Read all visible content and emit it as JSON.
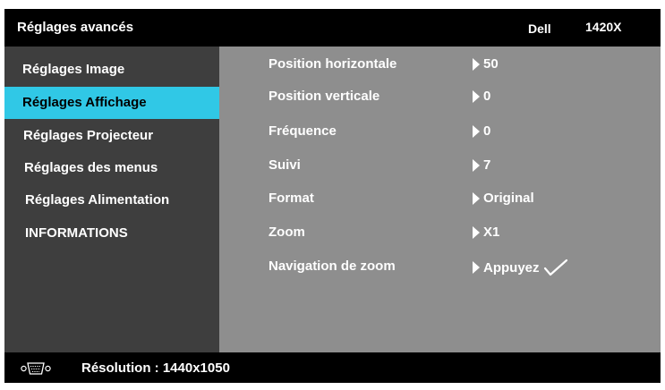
{
  "header": {
    "title": "Réglages avancés",
    "brand": "Dell",
    "model": "1420X"
  },
  "sidebar": {
    "items": [
      {
        "label": "Réglages Image",
        "active": false
      },
      {
        "label": "Réglages Affichage",
        "active": true
      },
      {
        "label": "Réglages Projecteur",
        "active": false
      },
      {
        "label": "Réglages des menus",
        "active": false
      },
      {
        "label": "Réglages Alimentation",
        "active": false
      },
      {
        "label": "INFORMATIONS",
        "active": false
      }
    ]
  },
  "settings": [
    {
      "label": "Position horizontale",
      "value": "50"
    },
    {
      "label": "Position verticale",
      "value": "0"
    },
    {
      "label": "Fréquence",
      "value": "0"
    },
    {
      "label": "Suivi",
      "value": "7"
    },
    {
      "label": "Format",
      "value": "Original"
    },
    {
      "label": "Zoom",
      "value": "X1"
    },
    {
      "label": "Navigation de zoom",
      "value": "Appuyez",
      "icon": "checkmark-icon"
    }
  ],
  "footer": {
    "icon": "vga-connector-icon",
    "resolution": "Résolution : 1440x1050"
  },
  "colors": {
    "header_bg": "#000000",
    "sidebar_bg": "#3e3e3e",
    "content_bg": "#8e8e8e",
    "active_bg": "#30c8e6",
    "active_text": "#000000",
    "text": "#ffffff"
  }
}
